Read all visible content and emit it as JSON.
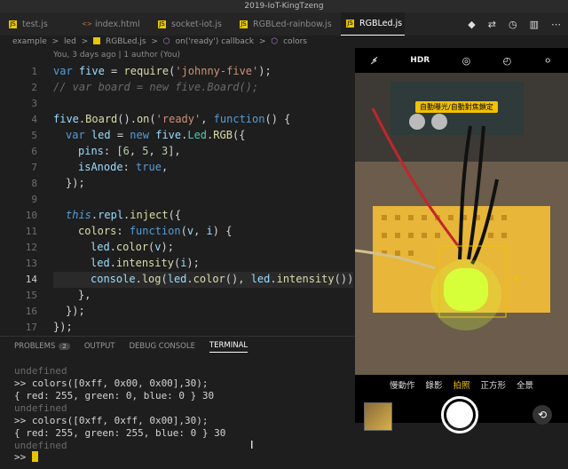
{
  "window": {
    "title": "2019-IoT-KingTzeng"
  },
  "tabs": [
    {
      "label": "test.js",
      "icon": "js-file-icon"
    },
    {
      "label": "index.html",
      "icon": "html-file-icon"
    },
    {
      "label": "socket-iot.js",
      "icon": "js-file-icon"
    },
    {
      "label": "RGBLed-rainbow.js",
      "icon": "js-file-icon"
    },
    {
      "label": "RGBLed.js",
      "icon": "js-file-icon",
      "active": true
    }
  ],
  "breadcrumb": [
    "example",
    ">",
    "led",
    ">",
    "RGBLed.js",
    ">",
    "on('ready') callback",
    ">",
    "colors"
  ],
  "blame": "You, 3 days ago | 1 author (You)",
  "line_numbers": [
    "1",
    "2",
    "3",
    "4",
    "5",
    "6",
    "7",
    "8",
    "9",
    "10",
    "11",
    "12",
    "13",
    "14",
    "15",
    "16",
    "17"
  ],
  "code": {
    "l1": [
      "var",
      " ",
      "five",
      " = ",
      "require",
      "(",
      "'johnny-five'",
      ");"
    ],
    "l2": "// var board = new five.Board();",
    "l4": [
      "five",
      ".",
      "Board",
      "().",
      "on",
      "(",
      "'ready'",
      ", ",
      "function",
      "() {"
    ],
    "l5": [
      "var",
      " ",
      "led",
      " = ",
      "new",
      " ",
      "five",
      ".",
      "Led",
      ".",
      "RGB",
      "({"
    ],
    "l6": [
      "pins",
      ": [",
      "6",
      ", ",
      "5",
      ", ",
      "3",
      "],"
    ],
    "l7": [
      "isAnode",
      ": ",
      "true",
      ","
    ],
    "l8": "});",
    "l10": [
      "this",
      ".",
      "repl",
      ".",
      "inject",
      "({"
    ],
    "l11": [
      "colors",
      ": ",
      "function",
      "(",
      "v",
      ", ",
      "i",
      ") {"
    ],
    "l12": [
      "led",
      ".",
      "color",
      "(",
      "v",
      ");"
    ],
    "l13": [
      "led",
      ".",
      "intensity",
      "(",
      "i",
      ");"
    ],
    "l14": [
      "console",
      ".",
      "log",
      "(",
      "led",
      ".",
      "color",
      "(), ",
      "led",
      ".",
      "intensity",
      "());"
    ],
    "l15": "},",
    "l16": "});",
    "l17": "});"
  },
  "panel": {
    "tabs": [
      "PROBLEMS",
      "OUTPUT",
      "DEBUG CONSOLE",
      "TERMINAL"
    ],
    "problems_count": "2",
    "active": "TERMINAL"
  },
  "terminal": {
    "lines": [
      "undefined",
      ">> colors([0xff, 0x00, 0x00],30);",
      "{ red: 255, green: 0, blue: 0 } 30",
      "undefined",
      ">> colors([0xff, 0xff, 0x00],30);",
      "{ red: 255, green: 255, blue: 0 } 30",
      "undefined",
      ">> "
    ]
  },
  "camera": {
    "hdr": "HDR",
    "banner": "自動曝光/自動對焦鎖定",
    "modes": [
      "慢動作",
      "錄影",
      "拍照",
      "正方形",
      "全景"
    ],
    "active_mode": "拍照"
  },
  "colors": {
    "accent_yellow": "#f2c200",
    "led_glow": "#d6ff3a"
  }
}
